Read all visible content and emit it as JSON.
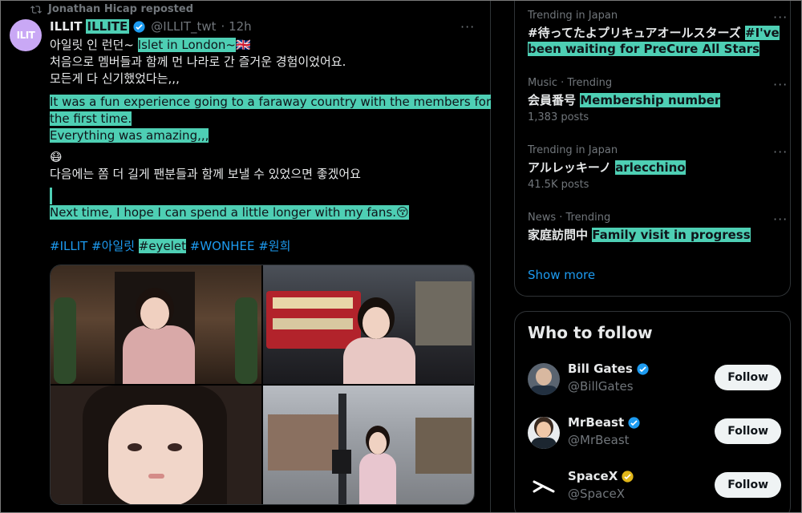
{
  "tweet": {
    "repost_text": "Jonathan Hicap reposted",
    "avatar_text": "ILIT",
    "author_name": "ILLIT",
    "author_name_hl": "ILLITE",
    "handle": "@ILLIT_twt",
    "time": "· 12h",
    "lines": {
      "l1a": "아일릿 인 런던~ ",
      "l1b": "Islet in London~",
      "l1c": "🇬🇧",
      "l2": "처음으로 멤버들과 함께 먼 나라로 간 즐거운 경험이었어요.",
      "l3": "모든게 다 신기했었다는,,,",
      "t1": "It was a fun experience going to a faraway country with the members for",
      "t2": "the first time.",
      "t3": " Everything was amazing,,,",
      "emoji": "😷",
      "l4": "다음에는 쫌 더 길게 팬분들과 함께 보낼 수 있었으면 좋겠어요",
      "t4": "Next time, I hope I can spend a little longer with my fans.",
      "t4e": "😚"
    },
    "hashtags": {
      "h1": "#ILLIT #아일릿 ",
      "h2": "#eyelet",
      "h3": " #WONHEE #원희"
    }
  },
  "trends": [
    {
      "meta": "Trending in Japan",
      "title_a": "#待ってたよプリキュアオールスターズ ",
      "title_b": "#I've been waiting for PreCure All Stars",
      "count": ""
    },
    {
      "meta": "Music · Trending",
      "title_a": "会員番号 ",
      "title_b": "Membership number",
      "count": "1,383 posts"
    },
    {
      "meta": "Trending in Japan",
      "title_a": "アルレッキーノ ",
      "title_b": "arlecchino",
      "count": "41.5K posts"
    },
    {
      "meta": "News · Trending",
      "title_a": "家庭訪問中 ",
      "title_b": "Family visit in progress",
      "count": ""
    }
  ],
  "show_more": "Show more",
  "follow": {
    "title": "Who to follow",
    "button": "Follow",
    "accounts": [
      {
        "name": "Bill Gates",
        "handle": "@BillGates"
      },
      {
        "name": "MrBeast",
        "handle": "@MrBeast"
      },
      {
        "name": "SpaceX",
        "handle": "@SpaceX"
      }
    ]
  }
}
